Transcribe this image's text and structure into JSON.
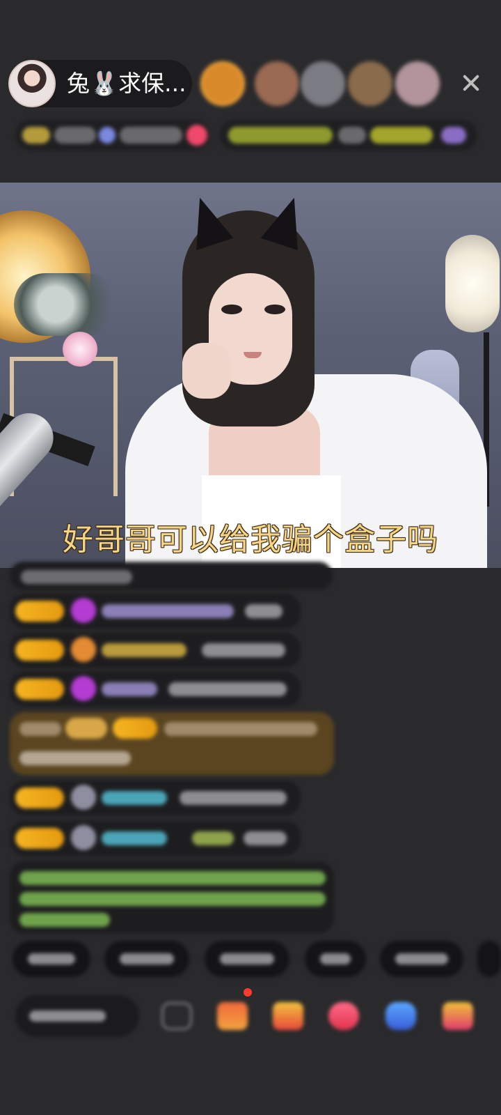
{
  "header": {
    "host_name": "兔🐰求保...",
    "close_label": "close"
  },
  "video": {
    "subtitle": "好哥哥可以给我骗个盒子吗"
  },
  "colors": {
    "background": "#2a2a2c",
    "subtitle": "#f5d487",
    "badge_gold": "#f6b521",
    "notify_red": "#ff3b30"
  },
  "icons": [
    "host-avatar",
    "close-icon",
    "gift-icon",
    "treasure-icon",
    "heart-icon",
    "game-icon",
    "shop-icon",
    "emoji-icon"
  ]
}
